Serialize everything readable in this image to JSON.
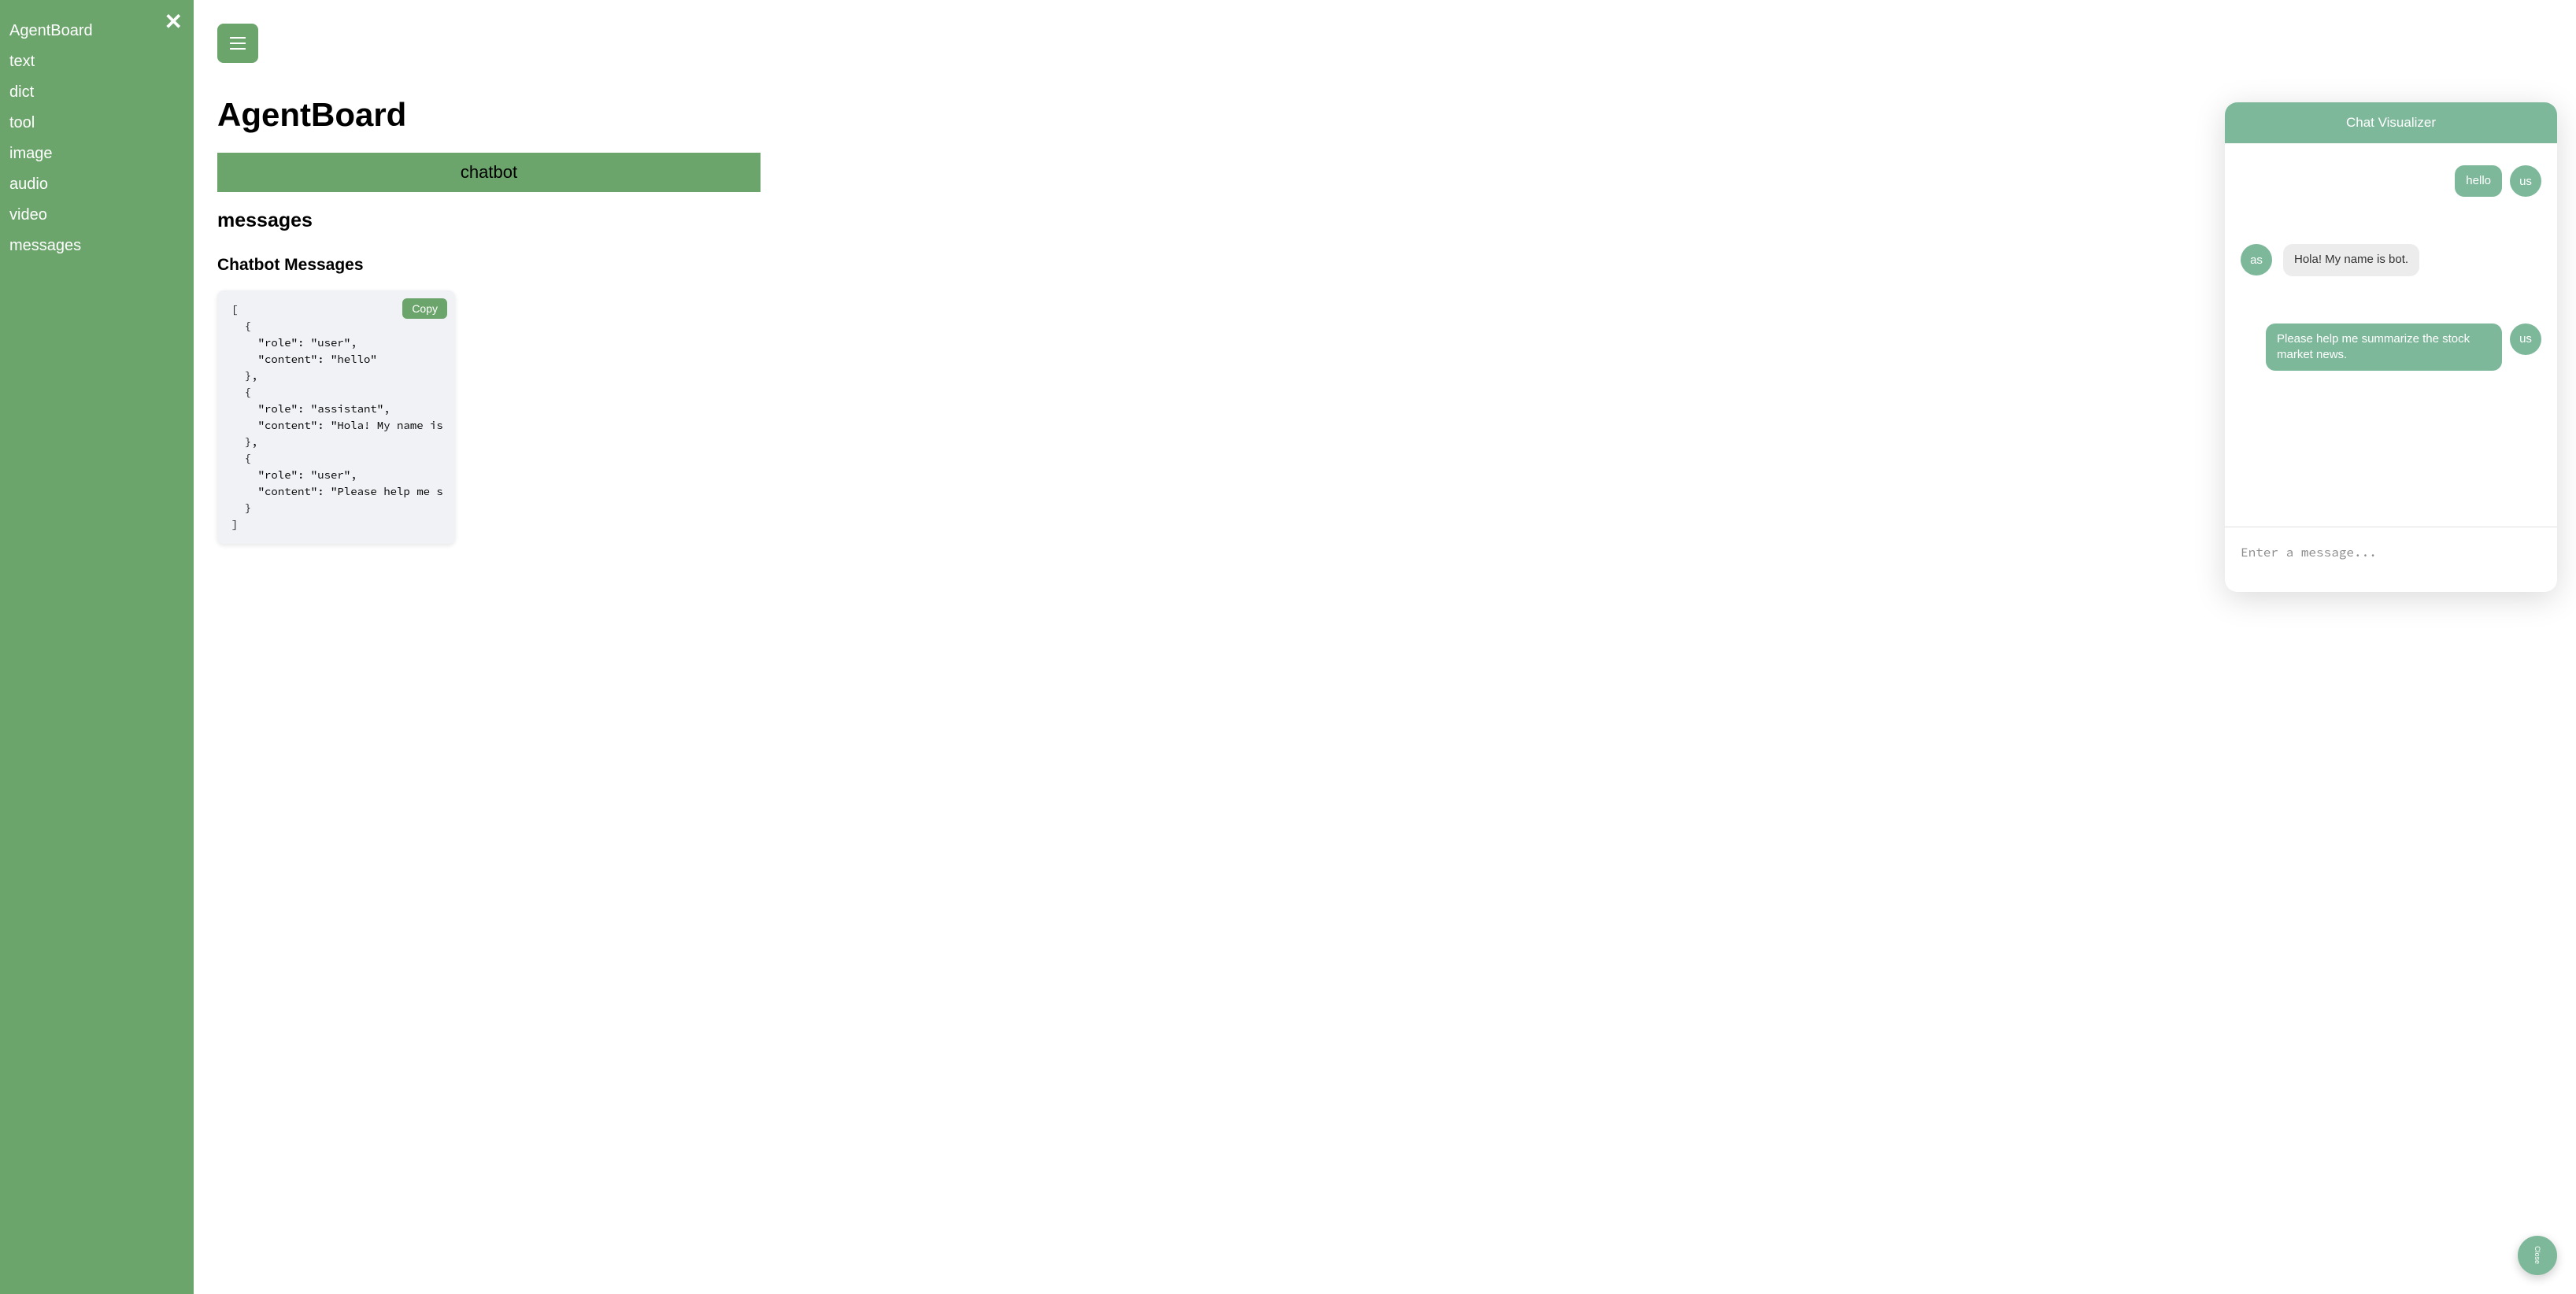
{
  "sidebar": {
    "items": [
      {
        "label": "AgentBoard"
      },
      {
        "label": "text"
      },
      {
        "label": "dict"
      },
      {
        "label": "tool"
      },
      {
        "label": "image"
      },
      {
        "label": "audio"
      },
      {
        "label": "video"
      },
      {
        "label": "messages"
      }
    ]
  },
  "main": {
    "title": "AgentBoard",
    "tab_label": "chatbot",
    "section_heading": "messages",
    "subsection_heading": "Chatbot Messages",
    "copy_label": "Copy",
    "code_text": "[\n  {\n    \"role\": \"user\",\n    \"content\": \"hello\"\n  },\n  {\n    \"role\": \"assistant\",\n    \"content\": \"Hola! My name is \n  },\n  {\n    \"role\": \"user\",\n    \"content\": \"Please help me s\n  }\n]"
  },
  "chat": {
    "header": "Chat Visualizer",
    "user_avatar": "us",
    "assistant_avatar": "as",
    "messages": [
      {
        "role": "user",
        "text": "hello"
      },
      {
        "role": "assistant",
        "text": "Hola! My name is bot."
      },
      {
        "role": "user",
        "text": "Please help me summarize the stock market news."
      }
    ],
    "input_placeholder": "Enter a message...",
    "close_label": "Close"
  }
}
